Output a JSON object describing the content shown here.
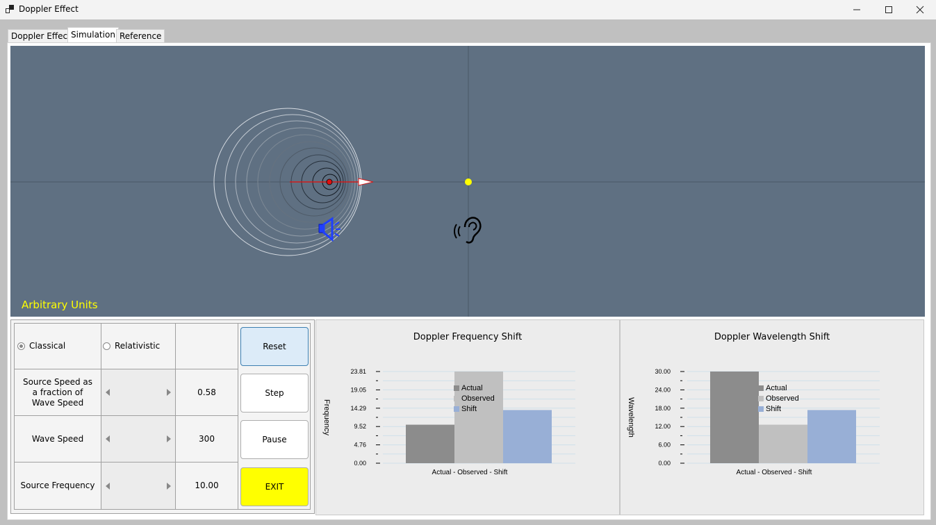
{
  "window": {
    "title": "Doppler Effect",
    "minimize_icon": "minimize-icon",
    "maximize_icon": "maximize-icon",
    "close_icon": "close-icon"
  },
  "tabs": [
    {
      "label": "Doppler Effect"
    },
    {
      "label": "Simulation",
      "active": true
    },
    {
      "label": "Reference"
    }
  ],
  "simulation": {
    "units_label": "Arbitrary Units",
    "background": "#5f7082",
    "units_color": "#ffff00",
    "source_icon": "speaker-icon",
    "observer_icon": "ear-icon"
  },
  "controls": {
    "modes": [
      {
        "label": "Classical",
        "selected": true
      },
      {
        "label": "Relativistic",
        "selected": false
      }
    ],
    "rows": [
      {
        "label": "Source Speed as a fraction of Wave Speed",
        "value": "0.58"
      },
      {
        "label": "Wave Speed",
        "value": "300"
      },
      {
        "label": "Source Frequency",
        "value": "10.00"
      }
    ],
    "buttons": {
      "reset": "Reset",
      "step": "Step",
      "pause": "Pause",
      "exit": "EXIT"
    },
    "exit_color": "#ffff00"
  },
  "chart_data": [
    {
      "type": "bar",
      "title": "Doppler Frequency Shift",
      "ylabel": "Frequency",
      "xlabel": "Actual -  Observed  -  Shift",
      "categories": [
        "Actual",
        "Observed",
        "Shift"
      ],
      "values": [
        10.0,
        23.81,
        13.81
      ],
      "yticks": [
        "0.00",
        "4.76",
        "9.52",
        "14.29",
        "19.05",
        "23.81"
      ],
      "ylim": [
        0,
        23.81
      ],
      "legend": [
        "Actual",
        "Observed",
        "Shift"
      ],
      "legend_position": "top-center",
      "colors": [
        "#8c8c8c",
        "#c0c0c0",
        "#98afd6"
      ]
    },
    {
      "type": "bar",
      "title": "Doppler Wavelength Shift",
      "ylabel": "Wavelength",
      "xlabel": "Actual -  Observed  -  Shift",
      "categories": [
        "Actual",
        "Observed",
        "Shift"
      ],
      "values": [
        30.0,
        12.6,
        17.4
      ],
      "yticks": [
        "0.00",
        "6.00",
        "12.00",
        "18.00",
        "24.00",
        "30.00"
      ],
      "ylim": [
        0,
        30
      ],
      "legend": [
        "Actual",
        "Observed",
        "Shift"
      ],
      "legend_position": "top-center",
      "colors": [
        "#8c8c8c",
        "#c0c0c0",
        "#98afd6"
      ]
    }
  ]
}
